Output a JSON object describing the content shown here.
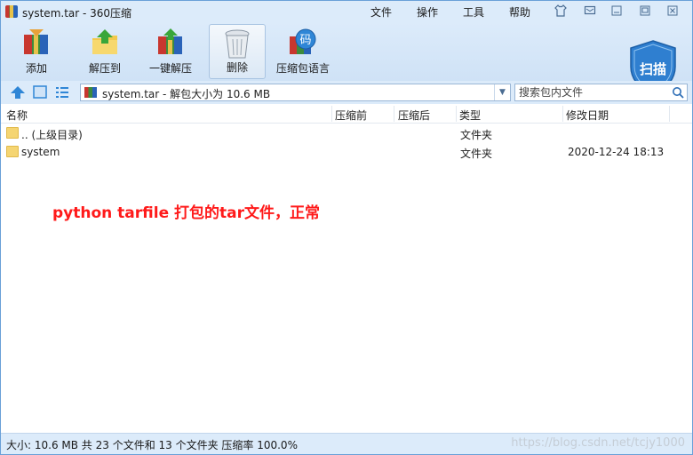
{
  "window": {
    "title": "system.tar - 360压缩"
  },
  "menu": {
    "items": [
      "文件",
      "操作",
      "工具",
      "帮助"
    ]
  },
  "toolbar": {
    "buttons": [
      {
        "label": "添加",
        "icon": "add-archive-icon"
      },
      {
        "label": "解压到",
        "icon": "extract-to-icon"
      },
      {
        "label": "一键解压",
        "icon": "one-click-extract-icon"
      },
      {
        "label": "删除",
        "icon": "delete-trash-icon"
      },
      {
        "label": "压缩包语言",
        "icon": "archive-language-icon"
      }
    ],
    "scan_label": "扫描",
    "language_badge": "码"
  },
  "address": {
    "path": "system.tar - 解包大小为 10.6 MB"
  },
  "search": {
    "placeholder": "搜索包内文件"
  },
  "columns": [
    "名称",
    "压缩前",
    "压缩后",
    "类型",
    "修改日期"
  ],
  "rows": [
    {
      "name": ".. (上级目录)",
      "type": "文件夹",
      "modified": ""
    },
    {
      "name": "system",
      "type": "文件夹",
      "modified": "2020-12-24 18:13"
    }
  ],
  "annotation": "python tarfile 打包的tar文件，正常",
  "status": {
    "text": "大小: 10.6 MB 共 23 个文件和 13 个文件夹 压缩率 100.0%",
    "watermark": "https://blog.csdn.net/tcjy1000"
  },
  "colors": {
    "chrome": "#dcebfa",
    "annotation": "#ff1a1a",
    "scan_shield": "#2f7fd0"
  }
}
